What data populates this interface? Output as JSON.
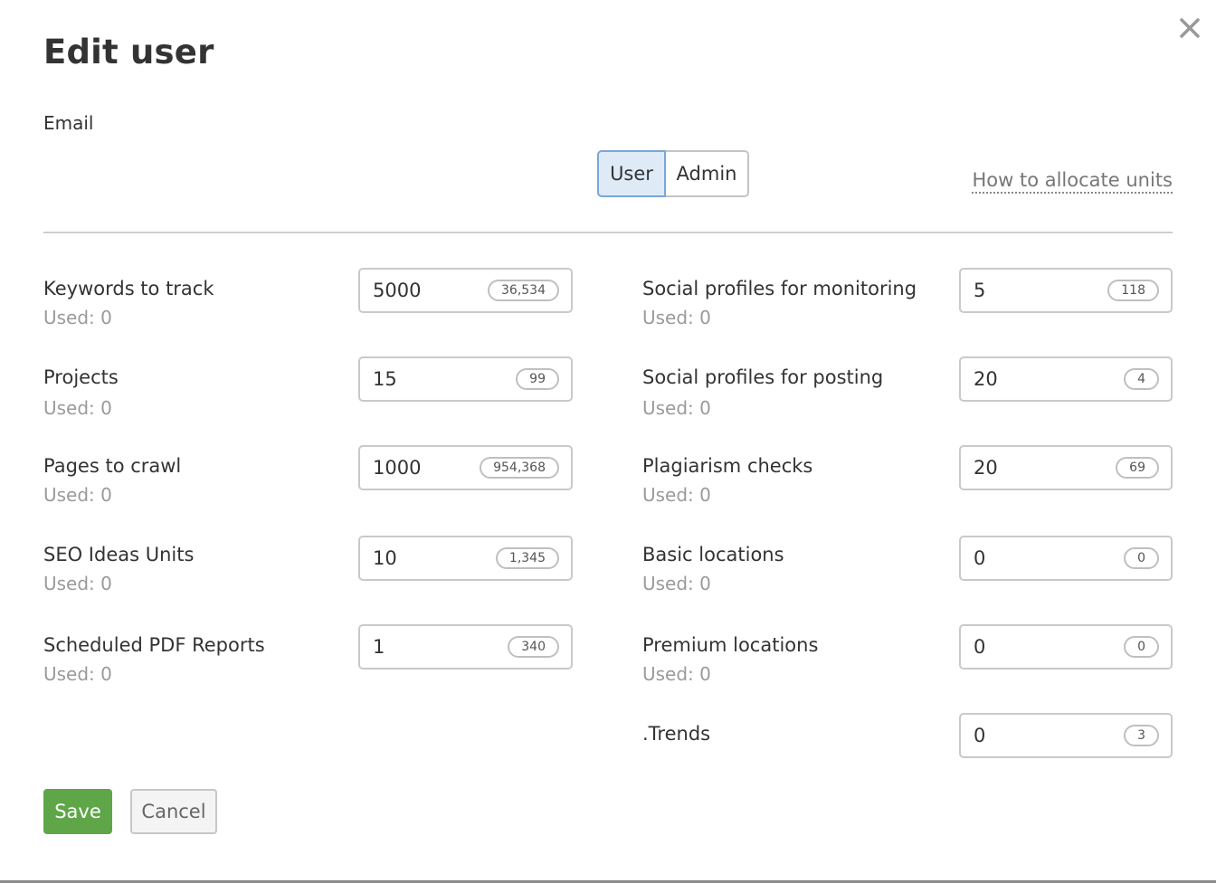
{
  "dialog": {
    "title": "Edit user",
    "email_label": "Email",
    "roles": [
      "User",
      "Admin"
    ],
    "selected_role": "User",
    "allocate_link": "How to allocate units"
  },
  "fields": {
    "keywords": {
      "label": "Keywords to track",
      "used": "Used: 0",
      "value": "5000",
      "available": "36,534"
    },
    "projects": {
      "label": "Projects",
      "used": "Used: 0",
      "value": "15",
      "available": "99"
    },
    "pages": {
      "label": "Pages to crawl",
      "used": "Used: 0",
      "value": "1000",
      "available": "954,368"
    },
    "seo_ideas": {
      "label": "SEO Ideas Units",
      "used": "Used: 0",
      "value": "10",
      "available": "1,345"
    },
    "pdf_reports": {
      "label": "Scheduled PDF Reports",
      "used": "Used: 0",
      "value": "1",
      "available": "340"
    },
    "social_monitoring": {
      "label": "Social profiles for monitoring",
      "used": "Used: 0",
      "value": "5",
      "available": "118"
    },
    "social_posting": {
      "label": "Social profiles for posting",
      "used": "Used: 0",
      "value": "20",
      "available": "4"
    },
    "plagiarism": {
      "label": "Plagiarism checks",
      "used": "Used: 0",
      "value": "20",
      "available": "69"
    },
    "basic_locations": {
      "label": "Basic locations",
      "used": "Used: 0",
      "value": "0",
      "available": "0"
    },
    "premium_locations": {
      "label": "Premium locations",
      "used": "Used: 0",
      "value": "0",
      "available": "0"
    },
    "trends": {
      "label": ".Trends",
      "value": "0",
      "available": "3"
    }
  },
  "actions": {
    "save": "Save",
    "cancel": "Cancel"
  },
  "colors": {
    "save_green": "#5fa648",
    "selected_role_bg": "#dfeaf7",
    "selected_role_border": "#7aa6d8",
    "used_text": "#9a9a9a"
  },
  "icons": {
    "close": "close-icon"
  }
}
